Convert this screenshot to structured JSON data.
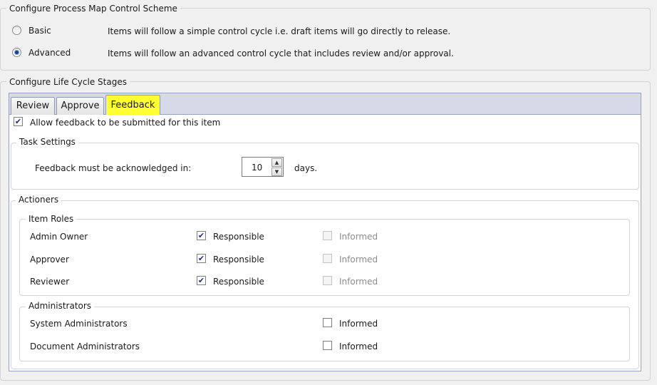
{
  "control_scheme": {
    "title": "Configure Process Map Control Scheme",
    "options": [
      {
        "label": "Basic",
        "description": "Items will follow a simple control cycle i.e. draft items will go directly to release.",
        "selected": false
      },
      {
        "label": "Advanced",
        "description": "Items will follow an advanced control cycle that includes review and/or approval.",
        "selected": true
      }
    ]
  },
  "lifecycle": {
    "title": "Configure Life Cycle Stages",
    "tabs": [
      {
        "label": "Review",
        "active": false
      },
      {
        "label": "Approve",
        "active": false
      },
      {
        "label": "Feedback",
        "active": true
      }
    ],
    "allow_feedback": {
      "label": "Allow feedback to be submitted for this item",
      "checked": true,
      "check_glyph": "✔"
    },
    "task_settings": {
      "title": "Task Settings",
      "acknowledge_label": "Feedback must be acknowledged in:",
      "acknowledge_value": "10",
      "acknowledge_unit": "days."
    },
    "actioners": {
      "title": "Actioners",
      "item_roles": {
        "title": "Item Roles",
        "rows": [
          {
            "name": "Admin Owner",
            "responsible_label": "Responsible",
            "responsible": true,
            "informed_label": "Informed",
            "informed": false
          },
          {
            "name": "Approver",
            "responsible_label": "Responsible",
            "responsible": true,
            "informed_label": "Informed",
            "informed": false
          },
          {
            "name": "Reviewer",
            "responsible_label": "Responsible",
            "responsible": true,
            "informed_label": "Informed",
            "informed": false
          }
        ]
      },
      "administrators": {
        "title": "Administrators",
        "rows": [
          {
            "name": "System Administrators",
            "informed_label": "Informed",
            "informed": false
          },
          {
            "name": "Document Administrators",
            "informed_label": "Informed",
            "informed": false
          }
        ]
      }
    }
  },
  "colors": {
    "tab_highlight": "#ffff33",
    "tab_strip": "#d6d9e8",
    "checkmark": "#1f2f6f"
  },
  "icons": {
    "spin_up": "▲",
    "spin_down": "▼"
  }
}
